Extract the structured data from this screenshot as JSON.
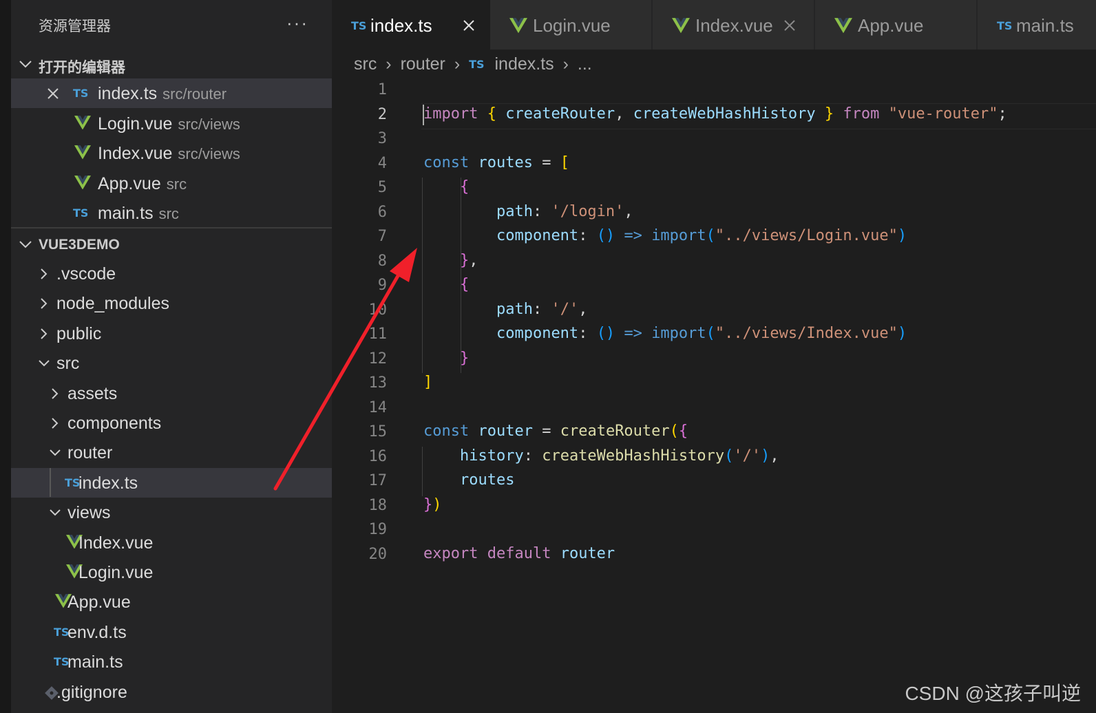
{
  "sidebar": {
    "title": "资源管理器",
    "more": "···",
    "open_editors": {
      "header": "打开的编辑器",
      "items": [
        {
          "icon": "ts-icon",
          "name": "index.ts",
          "desc": "src/router"
        },
        {
          "icon": "vue-icon",
          "name": "Login.vue",
          "desc": "src/views"
        },
        {
          "icon": "vue-icon",
          "name": "Index.vue",
          "desc": "src/views"
        },
        {
          "icon": "vue-icon",
          "name": "App.vue",
          "desc": "src"
        },
        {
          "icon": "ts-icon",
          "name": "main.ts",
          "desc": "src"
        }
      ]
    },
    "project": {
      "header": "VUE3DEMO",
      "tree": [
        {
          "name": ".vscode",
          "kind": "folder-collapsed"
        },
        {
          "name": "node_modules",
          "kind": "folder-collapsed"
        },
        {
          "name": "public",
          "kind": "folder-collapsed"
        },
        {
          "name": "src",
          "kind": "folder-expanded"
        },
        {
          "name": "assets",
          "kind": "folder-collapsed"
        },
        {
          "name": "components",
          "kind": "folder-collapsed"
        },
        {
          "name": "router",
          "kind": "folder-expanded"
        },
        {
          "name": "index.ts",
          "kind": "ts-file",
          "selected": true
        },
        {
          "name": "views",
          "kind": "folder-expanded"
        },
        {
          "name": "Index.vue",
          "kind": "vue-file"
        },
        {
          "name": "Login.vue",
          "kind": "vue-file"
        },
        {
          "name": "App.vue",
          "kind": "vue-file"
        },
        {
          "name": "env.d.ts",
          "kind": "ts-file"
        },
        {
          "name": "main.ts",
          "kind": "ts-file"
        },
        {
          "name": ".gitignore",
          "kind": "git-file"
        }
      ]
    }
  },
  "tabs": [
    {
      "label": "index.ts",
      "icon": "ts-icon",
      "active": true,
      "close": true
    },
    {
      "label": "Login.vue",
      "icon": "vue-icon",
      "active": false,
      "close": false
    },
    {
      "label": "Index.vue",
      "icon": "vue-icon",
      "active": false,
      "close": true
    },
    {
      "label": "App.vue",
      "icon": "vue-icon",
      "active": false,
      "close": false
    },
    {
      "label": "main.ts",
      "icon": "ts-icon",
      "active": false,
      "close": false
    }
  ],
  "ts_badge": "TS",
  "breadcrumb": {
    "parts": [
      "src",
      "router",
      "index.ts",
      "..."
    ],
    "separator": "›"
  },
  "editor": {
    "current_line": 2,
    "line_numbers": [
      "1",
      "2",
      "3",
      "4",
      "5",
      "6",
      "7",
      "8",
      "9",
      "10",
      "11",
      "12",
      "13",
      "14",
      "15",
      "16",
      "17",
      "18",
      "19",
      "20"
    ],
    "lines": [
      [],
      [
        [
          "import",
          "kw2"
        ],
        [
          " ",
          "pl"
        ],
        [
          "{",
          "b1"
        ],
        [
          " ",
          "pl"
        ],
        [
          "createRouter",
          "var"
        ],
        [
          ", ",
          "pl"
        ],
        [
          "createWebHashHistory",
          "var"
        ],
        [
          " ",
          "pl"
        ],
        [
          "}",
          "b1"
        ],
        [
          " ",
          "pl"
        ],
        [
          "from",
          "kw2"
        ],
        [
          " ",
          "pl"
        ],
        [
          "\"vue-router\"",
          "str"
        ],
        [
          ";",
          "pl"
        ]
      ],
      [],
      [
        [
          "const",
          "kw"
        ],
        [
          " ",
          "pl"
        ],
        [
          "routes",
          "var"
        ],
        [
          " = ",
          "pl"
        ],
        [
          "[",
          "b1"
        ]
      ],
      [
        [
          "    ",
          "pl"
        ],
        [
          "{",
          "b2"
        ]
      ],
      [
        [
          "        ",
          "pl"
        ],
        [
          "path",
          "var"
        ],
        [
          ": ",
          "pl"
        ],
        [
          "'/login'",
          "str"
        ],
        [
          ",",
          "pl"
        ]
      ],
      [
        [
          "        ",
          "pl"
        ],
        [
          "component",
          "var"
        ],
        [
          ": ",
          "pl"
        ],
        [
          "()",
          "b3"
        ],
        [
          " ",
          "pl"
        ],
        [
          "=>",
          "kw"
        ],
        [
          " ",
          "pl"
        ],
        [
          "import",
          "kw"
        ],
        [
          "(",
          "b3"
        ],
        [
          "\"../views/Login.vue\"",
          "str"
        ],
        [
          ")",
          "b3"
        ]
      ],
      [
        [
          "    ",
          "pl"
        ],
        [
          "}",
          "b2"
        ],
        [
          ",",
          "pl"
        ]
      ],
      [
        [
          "    ",
          "pl"
        ],
        [
          "{",
          "b2"
        ]
      ],
      [
        [
          "        ",
          "pl"
        ],
        [
          "path",
          "var"
        ],
        [
          ": ",
          "pl"
        ],
        [
          "'/'",
          "str"
        ],
        [
          ",",
          "pl"
        ]
      ],
      [
        [
          "        ",
          "pl"
        ],
        [
          "component",
          "var"
        ],
        [
          ": ",
          "pl"
        ],
        [
          "()",
          "b3"
        ],
        [
          " ",
          "pl"
        ],
        [
          "=>",
          "kw"
        ],
        [
          " ",
          "pl"
        ],
        [
          "import",
          "kw"
        ],
        [
          "(",
          "b3"
        ],
        [
          "\"../views/Index.vue\"",
          "str"
        ],
        [
          ")",
          "b3"
        ]
      ],
      [
        [
          "    ",
          "pl"
        ],
        [
          "}",
          "b2"
        ]
      ],
      [
        [
          "]",
          "b1"
        ]
      ],
      [],
      [
        [
          "const",
          "kw"
        ],
        [
          " ",
          "pl"
        ],
        [
          "router",
          "var"
        ],
        [
          " = ",
          "pl"
        ],
        [
          "createRouter",
          "fn"
        ],
        [
          "(",
          "b1"
        ],
        [
          "{",
          "b2"
        ]
      ],
      [
        [
          "    ",
          "pl"
        ],
        [
          "history",
          "var"
        ],
        [
          ": ",
          "pl"
        ],
        [
          "createWebHashHistory",
          "fn"
        ],
        [
          "(",
          "b3"
        ],
        [
          "'/'",
          "str"
        ],
        [
          ")",
          "b3"
        ],
        [
          ",",
          "pl"
        ]
      ],
      [
        [
          "    ",
          "pl"
        ],
        [
          "routes",
          "var"
        ]
      ],
      [
        [
          "}",
          "b2"
        ],
        [
          ")",
          "b1"
        ]
      ],
      [],
      [
        [
          "export",
          "kw2"
        ],
        [
          " ",
          "pl"
        ],
        [
          "default",
          "kw2"
        ],
        [
          " ",
          "pl"
        ],
        [
          "router",
          "var"
        ]
      ]
    ]
  },
  "watermark": "CSDN @这孩子叫逆",
  "colors": {
    "arrow": "#f0202a",
    "vue_green": "#8dc149",
    "ts_blue": "#4a9fd8"
  }
}
